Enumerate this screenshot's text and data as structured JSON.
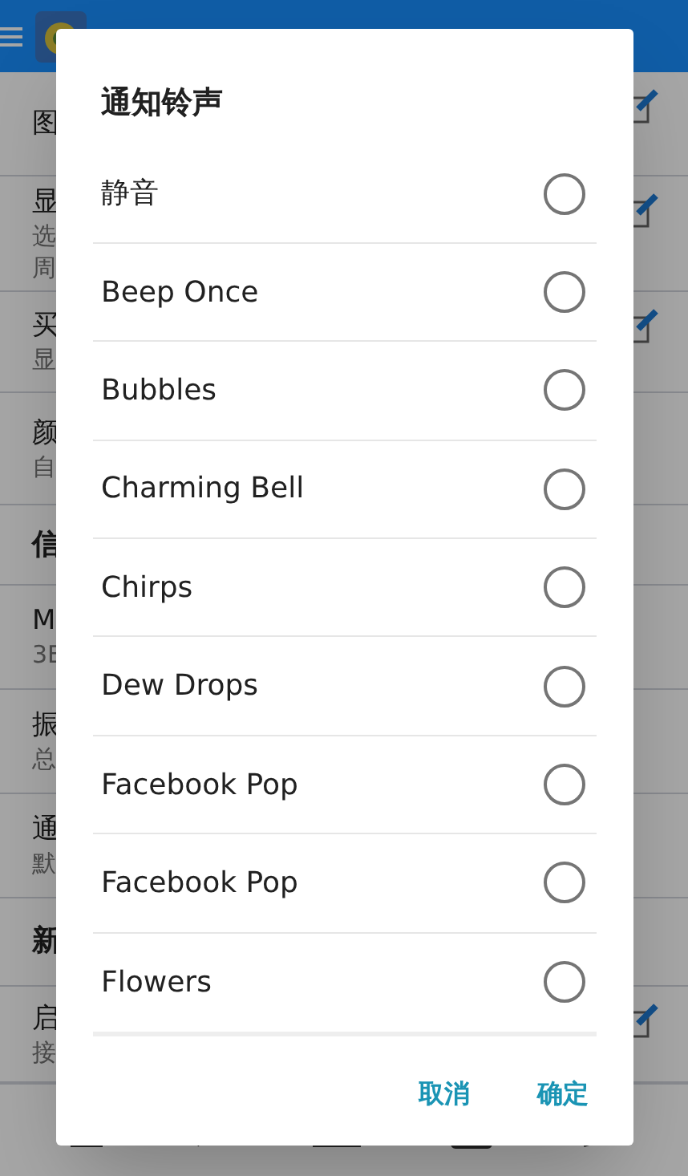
{
  "background": {
    "rows": [
      {
        "kind": "item",
        "lines": [
          "图"
        ],
        "editable": true
      },
      {
        "kind": "item",
        "lines": [
          "显",
          "选",
          "周"
        ],
        "editable": true
      },
      {
        "kind": "item",
        "lines": [
          "买",
          "显"
        ],
        "editable": true
      },
      {
        "kind": "item",
        "lines": [
          "颜",
          "自"
        ],
        "editable": false
      },
      {
        "kind": "section",
        "lines": [
          "信"
        ],
        "editable": false
      },
      {
        "kind": "item",
        "lines": [
          "M",
          "3E"
        ],
        "editable": false
      },
      {
        "kind": "item",
        "lines": [
          "振",
          "总"
        ],
        "editable": false
      },
      {
        "kind": "item",
        "lines": [
          "通",
          "默"
        ],
        "editable": false
      },
      {
        "kind": "section",
        "lines": [
          "新"
        ],
        "editable": false
      },
      {
        "kind": "item",
        "lines": [
          "启",
          "接"
        ],
        "editable": true
      }
    ]
  },
  "dialog": {
    "title": "通知铃声",
    "options": [
      {
        "label": "静音",
        "selected": false
      },
      {
        "label": "Beep Once",
        "selected": false
      },
      {
        "label": "Bubbles",
        "selected": false
      },
      {
        "label": "Charming Bell",
        "selected": false
      },
      {
        "label": "Chirps",
        "selected": false
      },
      {
        "label": "Dew Drops",
        "selected": false
      },
      {
        "label": "Facebook Pop",
        "selected": false
      },
      {
        "label": "Facebook Pop",
        "selected": false
      },
      {
        "label": "Flowers",
        "selected": false
      }
    ],
    "buttons": [
      "取消",
      "确定"
    ]
  }
}
